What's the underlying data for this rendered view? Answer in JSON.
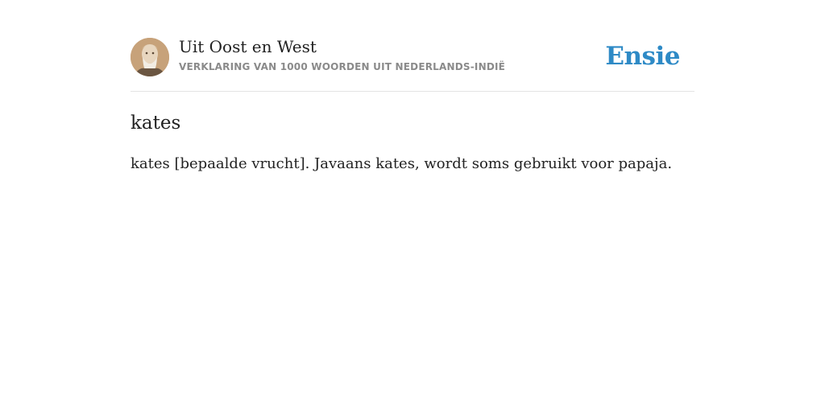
{
  "header": {
    "title": "Uit Oost en West",
    "subtitle": "VERKLARING VAN 1000 WOORDEN UIT NEDERLANDS-INDIË",
    "brand": "Ensie",
    "avatar_icon": "author-portrait-icon"
  },
  "entry": {
    "term": "kates",
    "definition": "kates [bepaalde vrucht]. Javaans kates, wordt soms gebruikt voor papaja."
  },
  "colors": {
    "brand": "#2e8ac6",
    "text": "#222222",
    "muted": "#8a8a8a",
    "divider": "#e3e3e3"
  }
}
